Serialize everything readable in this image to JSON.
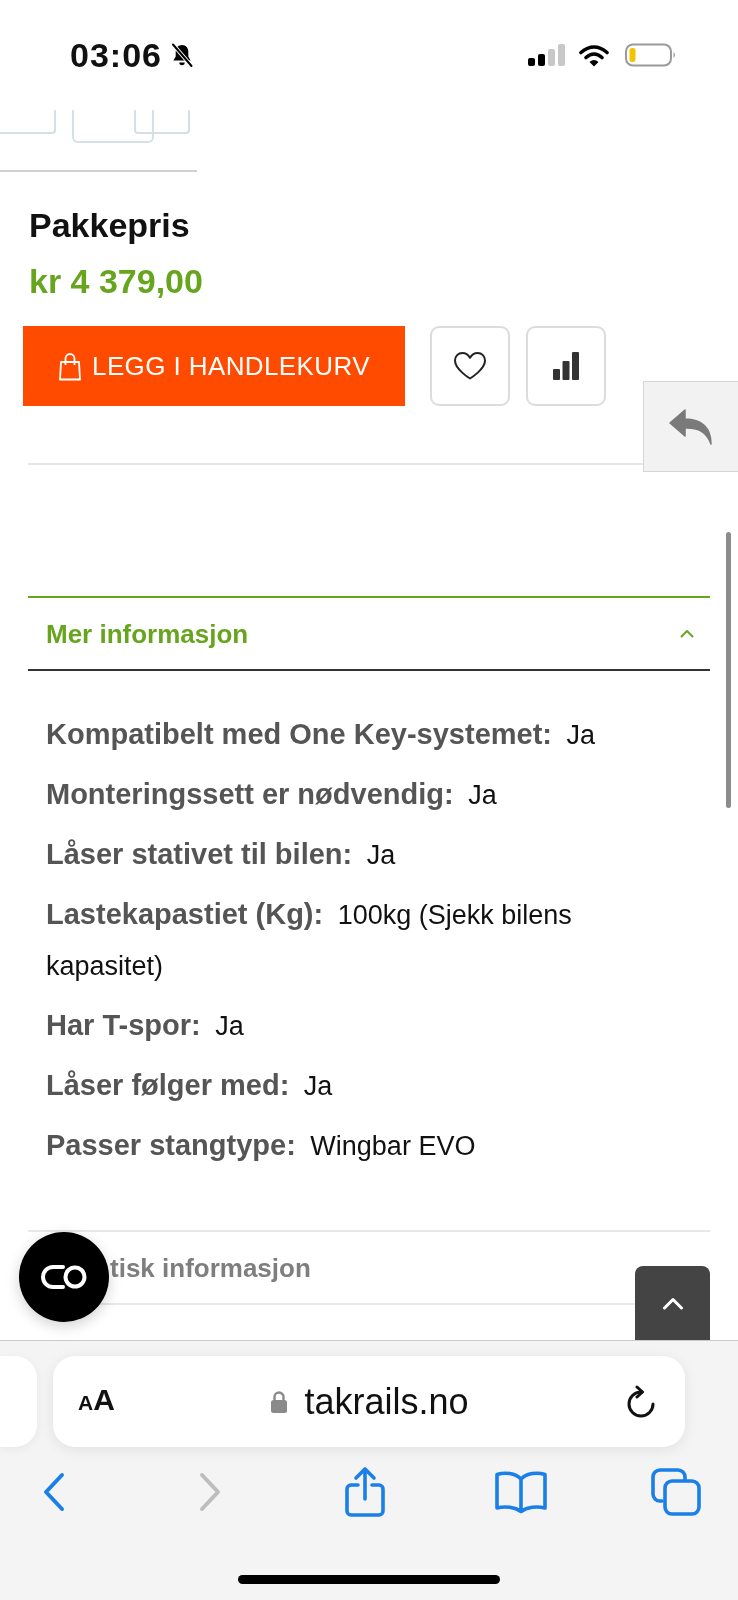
{
  "status_bar": {
    "time": "03:06"
  },
  "product": {
    "title": "Pakkepris",
    "price": "kr 4 379,00",
    "add_to_cart": "LEGG I HANDLEKURV"
  },
  "accordion": [
    {
      "title": "Mer informasjon",
      "expanded": true,
      "specs": [
        {
          "label": "Kompatibelt med One Key-systemet:",
          "value": "Ja"
        },
        {
          "label": "Monteringssett er nødvendig:",
          "value": "Ja"
        },
        {
          "label": "Låser stativet til bilen:",
          "value": "Ja"
        },
        {
          "label": "Lastekapastiet (Kg):",
          "value": "100kg (Sjekk bilens kapasitet)"
        },
        {
          "label": "Har T-spor:",
          "value": "Ja"
        },
        {
          "label": "Låser følger med:",
          "value": "Ja"
        },
        {
          "label": "Passer stangtype:",
          "value": "Wingbar EVO"
        }
      ]
    },
    {
      "title": "tisk informasjon",
      "expanded": false
    }
  ],
  "browser": {
    "text_size": "AA",
    "url": "takrails.no",
    "toolbar": [
      {
        "kind": "back",
        "disabled": false
      },
      {
        "kind": "forward",
        "disabled": true
      },
      {
        "kind": "share",
        "disabled": false
      },
      {
        "kind": "bookmarks",
        "disabled": false
      },
      {
        "kind": "tabs",
        "disabled": false
      }
    ]
  }
}
